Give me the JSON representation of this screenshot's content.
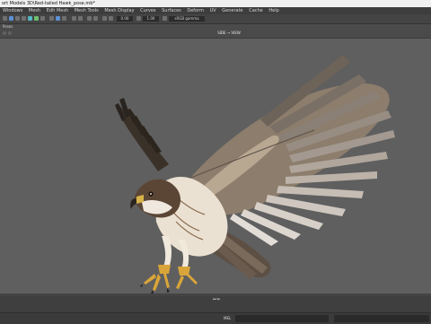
{
  "window": {
    "title": "ort Models 3D\\Red-tailed Hawk_pose.mb*"
  },
  "menubar": {
    "items": [
      "Windows",
      "Mesh",
      "Edit Mesh",
      "Mesh Tools",
      "Mesh Display",
      "Curves",
      "Surfaces",
      "Deform",
      "UV",
      "Generate",
      "Cache",
      "Help"
    ]
  },
  "toolbar": {
    "field_a": "0.00",
    "field_b": "1.00",
    "field_c": "sRGB gamma"
  },
  "shelf": {
    "label": "Poses"
  },
  "viewport": {
    "camera_label": "SIDE → VIEW",
    "bottom_label": "persp"
  },
  "commandline": {
    "label": "MEL"
  },
  "colors": {
    "viewport_bg": "#5f5f5f",
    "ui_dark": "#3d3d3d"
  }
}
